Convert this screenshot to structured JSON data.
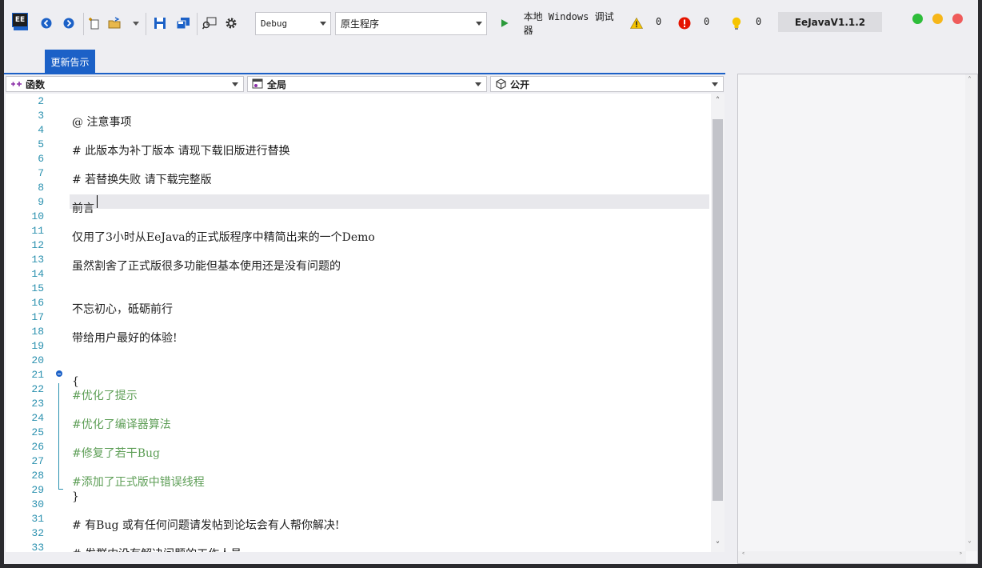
{
  "toolbar": {
    "app_icon_text": "EE",
    "config_value": "Debug",
    "platform_value": "原生程序",
    "run_label": "本地 Windows 调试器",
    "warnings_count": "0",
    "errors_count": "0",
    "messages_count": "0",
    "version_label": "EeJavaV1.1.2"
  },
  "colors": {
    "accent": "#1c61c7",
    "dot_green": "#2ebd3a",
    "dot_yellow": "#f6b619",
    "dot_red": "#ef5b5b",
    "line_number": "#2b91af",
    "comment": "#5d9e56"
  },
  "tabs": [
    {
      "label": "更新告示",
      "active": true
    }
  ],
  "navbar": {
    "scope_label": "函数",
    "context_label": "全局",
    "access_label": "公开"
  },
  "editor": {
    "lines": [
      {
        "n": "2",
        "text": ""
      },
      {
        "n": "3",
        "text": "@ 注意事项"
      },
      {
        "n": "4",
        "text": ""
      },
      {
        "n": "5",
        "text": "# 此版本为补丁版本 请现下载旧版进行替换"
      },
      {
        "n": "6",
        "text": ""
      },
      {
        "n": "7",
        "text": "# 若替换失败 请下载完整版"
      },
      {
        "n": "8",
        "text": ""
      },
      {
        "n": "9",
        "text": "前言"
      },
      {
        "n": "10",
        "text": ""
      },
      {
        "n": "11",
        "text": "仅用了3小时从EeJava的正式版程序中精简出来的一个Demo"
      },
      {
        "n": "12",
        "text": ""
      },
      {
        "n": "13",
        "text": "虽然割舍了正式版很多功能但基本使用还是没有问题的"
      },
      {
        "n": "14",
        "text": ""
      },
      {
        "n": "15",
        "text": ""
      },
      {
        "n": "16",
        "text": "不忘初心，砥砺前行"
      },
      {
        "n": "17",
        "text": ""
      },
      {
        "n": "18",
        "text": "带给用户最好的体验!"
      },
      {
        "n": "19",
        "text": ""
      },
      {
        "n": "20",
        "text": ""
      },
      {
        "n": "21",
        "text": "{"
      },
      {
        "n": "22",
        "text": "#优化了提示"
      },
      {
        "n": "23",
        "text": ""
      },
      {
        "n": "24",
        "text": "#优化了编译器算法"
      },
      {
        "n": "25",
        "text": ""
      },
      {
        "n": "26",
        "text": "#修复了若干Bug"
      },
      {
        "n": "27",
        "text": ""
      },
      {
        "n": "28",
        "text": "#添加了正式版中错误线程"
      },
      {
        "n": "29",
        "text": "}"
      },
      {
        "n": "30",
        "text": ""
      },
      {
        "n": "31",
        "text": "# 有Bug 或有任何问题请发帖到论坛会有人帮你解决!"
      },
      {
        "n": "32",
        "text": ""
      },
      {
        "n": "33",
        "text": "# 发群内没有解决问题的工作人员。"
      }
    ]
  }
}
